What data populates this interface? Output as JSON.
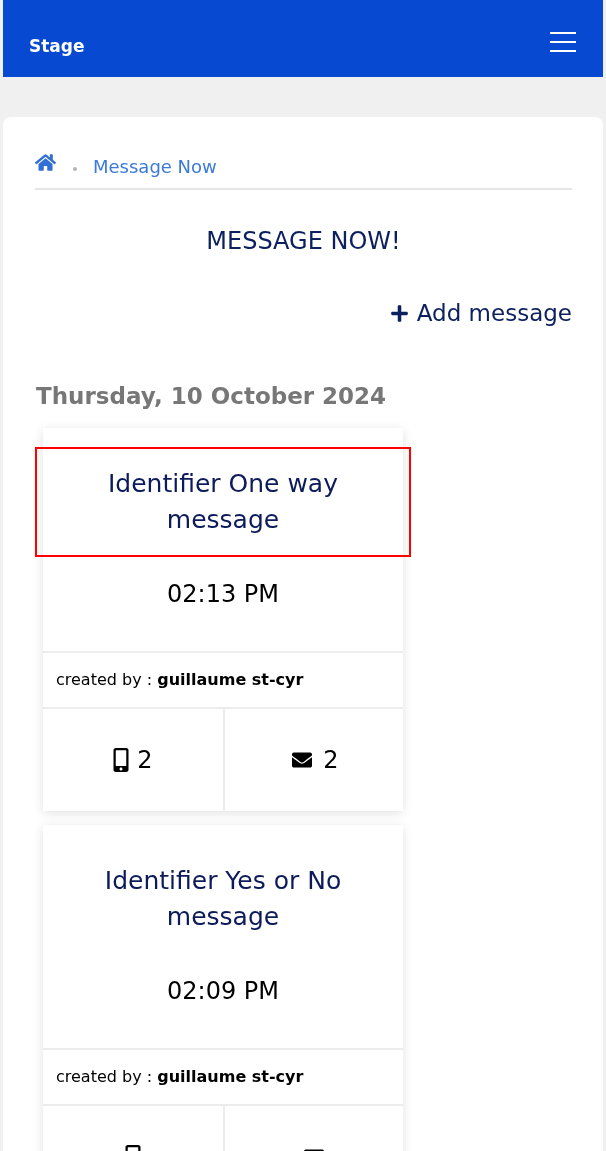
{
  "header": {
    "title": "Stage"
  },
  "breadcrumb": {
    "current": "Message Now"
  },
  "page_title": "MESSAGE NOW!",
  "add_button": {
    "label": "Add message"
  },
  "days": [
    {
      "date": "Thursday, 10 October 2024",
      "messages": [
        {
          "title": "Identifier One way message",
          "highlighted": true,
          "time": "02:13 PM",
          "created_by": "created by : **guillaume st-cyr**",
          "stats": [
            {
              "kind": "sms",
              "count": "2"
            },
            {
              "kind": "email",
              "count": "2"
            }
          ]
        },
        {
          "title": "Identifier Yes or No message",
          "highlighted": false,
          "time": "02:09 PM",
          "created_by": "created by : **guillaume st-cyr**",
          "stats": [
            {
              "kind": "sms"
            },
            {
              "kind": "email"
            }
          ]
        }
      ]
    }
  ]
}
